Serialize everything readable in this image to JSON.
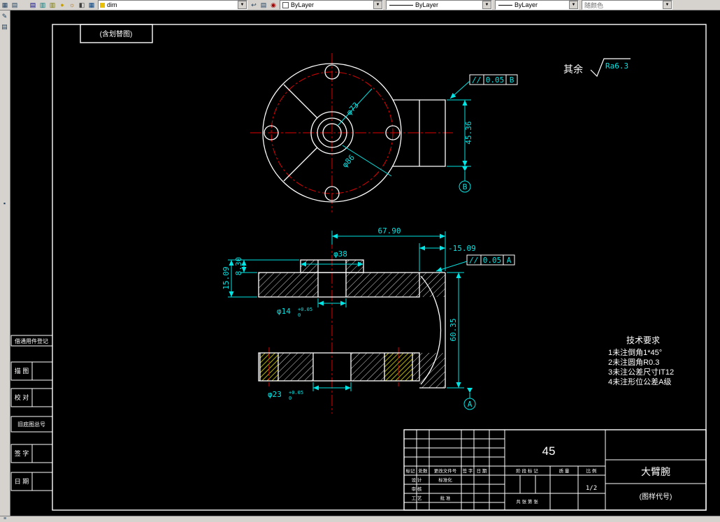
{
  "toolbar": {
    "icons_a": [
      {
        "name": "table-grid-icon",
        "glyph": "▦"
      },
      {
        "name": "sheet-grid-icon",
        "glyph": "▤"
      }
    ],
    "icons_b": [
      {
        "name": "layers-stack-icon",
        "glyph": "▤"
      },
      {
        "name": "sheet-cyan-icon",
        "glyph": "▥"
      },
      {
        "name": "sheet-yellow-icon",
        "glyph": "▥"
      },
      {
        "name": "bulb-icon",
        "glyph": "●"
      },
      {
        "name": "sun-icon",
        "glyph": "☼"
      },
      {
        "name": "lock-icon",
        "glyph": "◧"
      },
      {
        "name": "printer-icon",
        "glyph": "▦"
      }
    ],
    "layer_combo": {
      "value": "dim"
    },
    "icons_c": [
      {
        "name": "layer-previous-icon",
        "glyph": "↩"
      },
      {
        "name": "layer-states-icon",
        "glyph": "▤"
      },
      {
        "name": "color-wheel-icon",
        "glyph": "◉"
      }
    ],
    "color_combo": {
      "value": "ByLayer"
    },
    "linetype_combo": {
      "value": "ByLayer"
    },
    "lineweight_combo": {
      "value": "ByLayer"
    },
    "plotstyle_combo": {
      "value": "随颜色"
    }
  },
  "left_toolbar": {
    "icons": [
      {
        "name": "pencil-icon",
        "glyph": "✎"
      },
      {
        "name": "sheet-icon",
        "glyph": "▤"
      },
      {
        "name": "handle-icon",
        "glyph": "▪"
      }
    ]
  },
  "statusbar": {
    "icon": "≡"
  },
  "colors": {
    "dimension": "#00e5e5",
    "centerline": "#e00000",
    "geometry": "#ffffff",
    "hatch_accent": "#ffff00"
  },
  "frame": {
    "corner_note": "(含划替图)"
  },
  "side_boxes": [
    {
      "label": "借通用件登记"
    },
    {
      "label": "描  图"
    },
    {
      "label": "校  对"
    },
    {
      "label": "旧底图总号"
    },
    {
      "label": "签  字"
    },
    {
      "label": "日  期"
    }
  ],
  "surface_note": {
    "prefix": "其余",
    "roughness": "Ra6.3"
  },
  "top_view": {
    "dim_d73": "φ73",
    "dim_d86": "φ86",
    "dim_height": "45.36",
    "fcf_b": {
      "symbol": "//",
      "tolerance": "0.05",
      "datum": "B"
    },
    "datum_b": "B"
  },
  "section_view": {
    "dim_width": "67.90",
    "dim_offset_right": "-15.09",
    "dim_left_outer": "15.09",
    "dim_left_inner": "8.30",
    "dim_d38": "φ38",
    "dim_d14": "φ14",
    "d14_tol_upper": "+0.05",
    "d14_tol_lower": "0",
    "dim_d23": "φ23",
    "d23_tol_upper": "+0.05",
    "d23_tol_lower": "0",
    "dim_height": "60.35",
    "fcf_a": {
      "symbol": "//",
      "tolerance": "0.05",
      "datum": "A"
    },
    "datum_a": "A"
  },
  "tech_requirements": {
    "title": "技术要求",
    "lines": [
      "1未注倒角1*45°",
      "2未注圆角R0.3",
      "3未注公差尺寸IT12",
      "4未注形位公差A级"
    ]
  },
  "title_block": {
    "material": "45",
    "part_name": "大臂腕",
    "drawing_code": "(图样代号)",
    "sheet": "1/2",
    "row_labels": [
      "标记",
      "处数",
      "更改文件号",
      "签 字",
      "日 期"
    ],
    "role_labels": [
      "设 计",
      "标准化",
      "审 核",
      "工 艺",
      "批 准"
    ],
    "stage_label": "阶 段 标 记",
    "mass_label": "质 量",
    "scale_label": "比 例",
    "sheets_label": "共 张 第 张"
  }
}
